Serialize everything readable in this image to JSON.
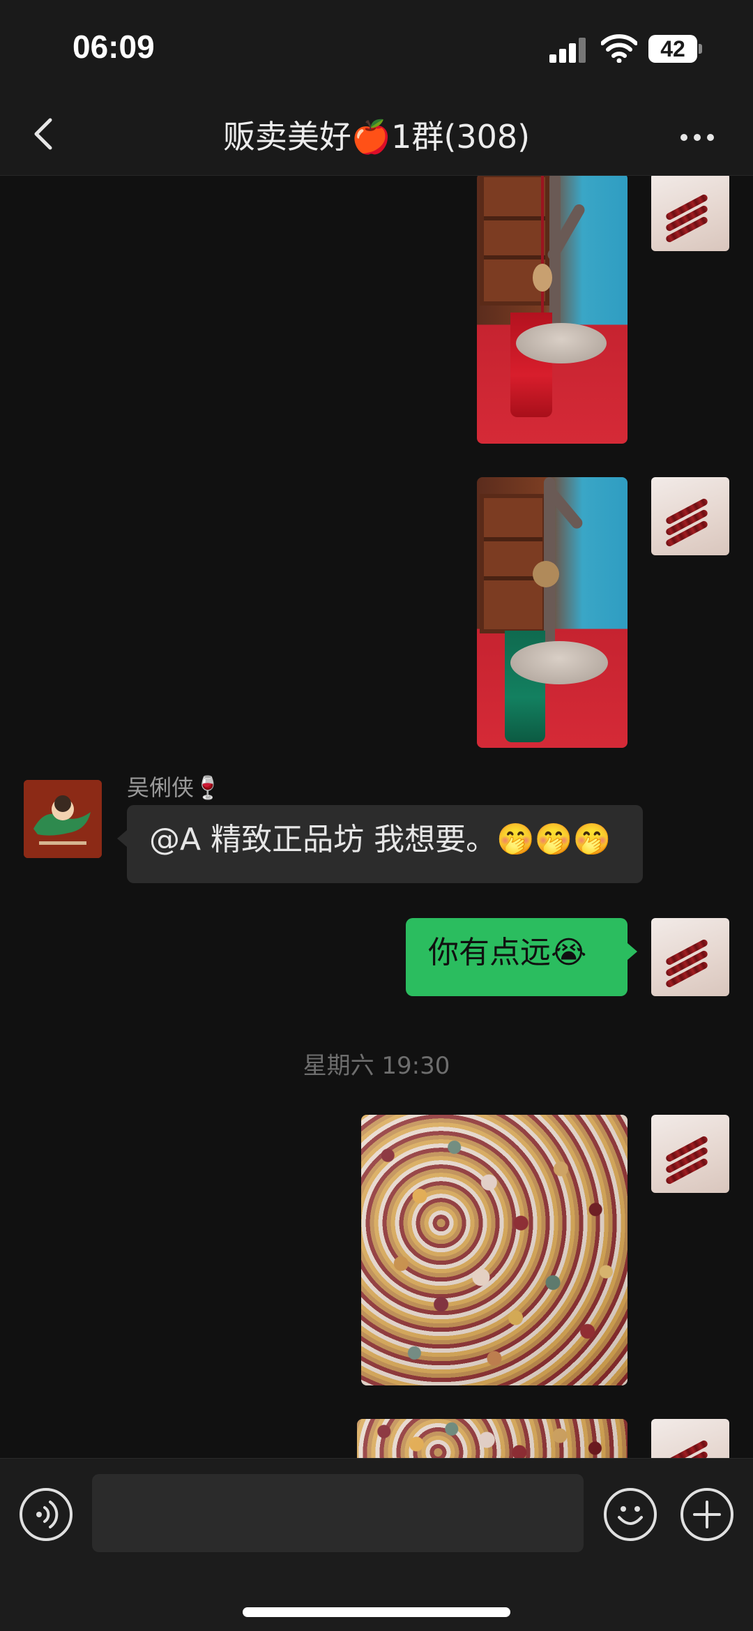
{
  "status_bar": {
    "time": "06:09",
    "battery": "42",
    "icons": [
      "cellular-signal-icon",
      "wifi-icon",
      "battery-icon"
    ]
  },
  "header": {
    "title": "贩卖美好🍎1群(308)",
    "back_icon": "chevron-left-icon",
    "more_icon": "more-dots-icon"
  },
  "messages": [
    {
      "from": "me",
      "type": "image",
      "subject": "red tassel pendant on wooden stand"
    },
    {
      "from": "me",
      "type": "image",
      "subject": "green tassel pendant on wooden stand"
    },
    {
      "from": "other",
      "type": "text",
      "sender": "吴俐侠🍷",
      "text": "@A 精致正品坊 我想要。🤭🤭🤭"
    },
    {
      "from": "me",
      "type": "text",
      "text": "你有点远😭"
    },
    {
      "from": "me",
      "type": "image",
      "subject": "assorted crystal bead bracelets"
    },
    {
      "from": "me",
      "type": "image",
      "subject": "crystal bead bracelets (partial)"
    }
  ],
  "time_divider": "星期六 19:30",
  "input_bar": {
    "voice_icon": "voice-input-icon",
    "text_value": "",
    "emoji_icon": "emoji-icon",
    "plus_icon": "plus-circle-icon"
  },
  "colors": {
    "background": "#111111",
    "bubble_out": "#2bbd5f",
    "bubble_in": "#2c2c2c"
  }
}
